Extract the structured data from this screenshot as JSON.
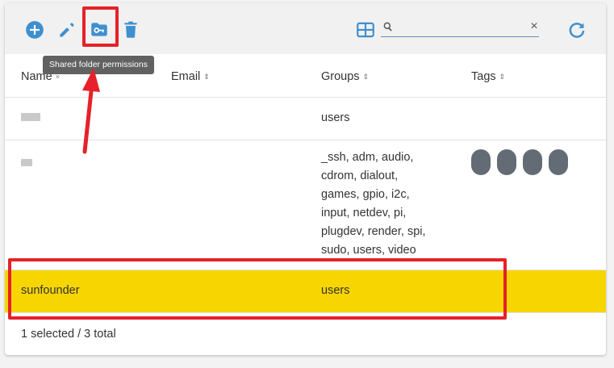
{
  "toolbar": {
    "add_icon": "plus-circle-icon",
    "edit_icon": "pencil-icon",
    "shared_folder_icon": "folder-key-icon",
    "delete_icon": "trash-icon",
    "grid_icon": "table-grid-icon",
    "refresh_icon": "refresh-icon",
    "search_value": "",
    "search_placeholder": "",
    "search_clear": "×"
  },
  "tooltip": "Shared folder permissions",
  "table": {
    "columns": [
      {
        "label": "Name",
        "sort": "×"
      },
      {
        "label": "Email",
        "sort": "⇕"
      },
      {
        "label": "Groups",
        "sort": "⇕"
      },
      {
        "label": "Tags",
        "sort": "⇕"
      }
    ],
    "rows": [
      {
        "name": "",
        "email": "",
        "groups": [
          "users"
        ],
        "tags": 0,
        "selected": false
      },
      {
        "name": "",
        "email": "",
        "groups": [
          "_ssh, adm, audio,",
          "cdrom, dialout,",
          "games, gpio, i2c,",
          "input, netdev, pi,",
          "plugdev, render, spi,",
          "sudo, users, video"
        ],
        "tags": 4,
        "selected": false
      },
      {
        "name": "sunfounder",
        "email": "",
        "groups": [
          "users"
        ],
        "tags": 0,
        "selected": true
      }
    ]
  },
  "footer": "1 selected / 3 total",
  "colors": {
    "accent": "#3f8fcf",
    "selected_row": "#f7d500",
    "tag": "#636c75",
    "annotation": "#e62129"
  }
}
